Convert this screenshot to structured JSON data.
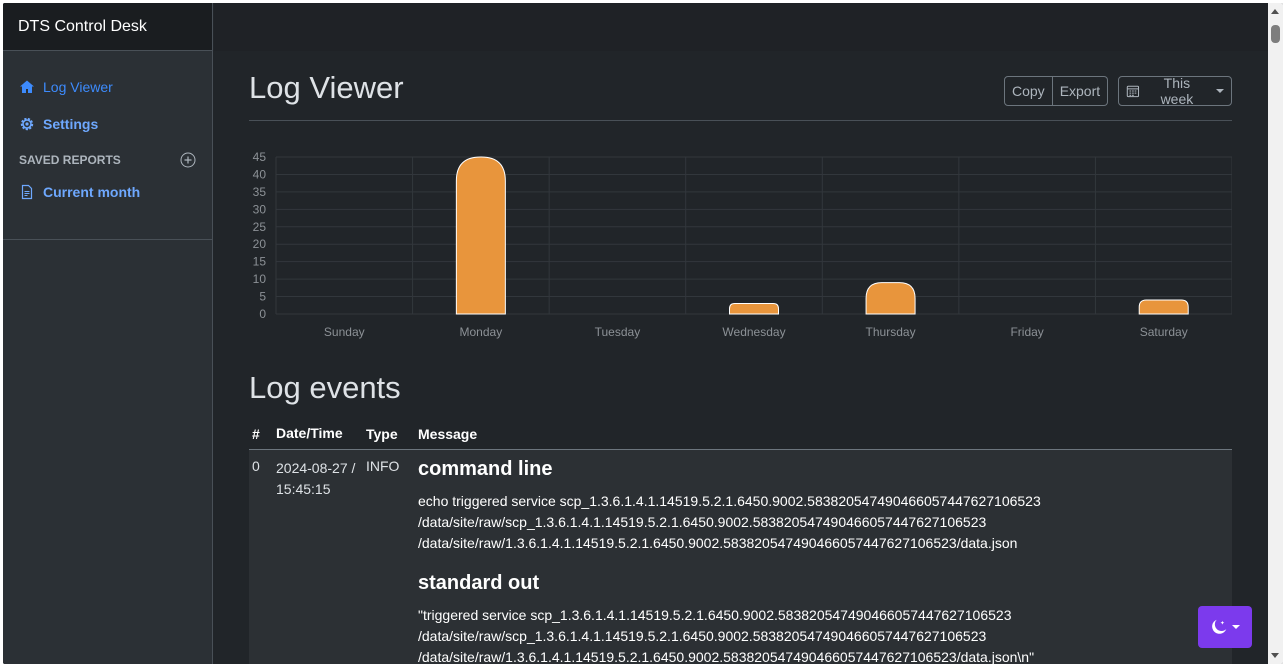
{
  "app": {
    "brand": "DTS Control Desk"
  },
  "sidebar": {
    "items": [
      {
        "label": "Log Viewer",
        "icon": "home-icon"
      },
      {
        "label": "Settings",
        "icon": "gear-icon"
      }
    ],
    "saved_reports_heading": "SAVED REPORTS",
    "reports": [
      {
        "label": "Current month",
        "icon": "document-icon"
      }
    ]
  },
  "header": {
    "title": "Log Viewer",
    "copy_label": "Copy",
    "export_label": "Export",
    "range_label": "This week"
  },
  "chart_data": {
    "type": "bar",
    "categories": [
      "Sunday",
      "Monday",
      "Tuesday",
      "Wednesday",
      "Thursday",
      "Friday",
      "Saturday"
    ],
    "values": [
      0,
      45,
      0,
      3,
      9,
      0,
      4
    ],
    "yticks": [
      0,
      5,
      10,
      15,
      20,
      25,
      30,
      35,
      40,
      45
    ],
    "ylim": [
      0,
      45
    ],
    "bar_color": "#e8953c",
    "grid": true
  },
  "events": {
    "title": "Log events",
    "columns": [
      "#",
      "Date/Time",
      "Type",
      "Message"
    ],
    "rows": [
      {
        "num": "0",
        "date": "2024-08-27 /",
        "time": "15:45:15",
        "type": "INFO",
        "sections": [
          {
            "heading": "command line",
            "lines": [
              "echo triggered service scp_1.3.6.1.4.1.14519.5.2.1.6450.9002.583820547490466057447627106523",
              "/data/site/raw/scp_1.3.6.1.4.1.14519.5.2.1.6450.9002.583820547490466057447627106523",
              "/data/site/raw/1.3.6.1.4.1.14519.5.2.1.6450.9002.583820547490466057447627106523/data.json"
            ]
          },
          {
            "heading": "standard out",
            "lines": [
              "\"triggered service scp_1.3.6.1.4.1.14519.5.2.1.6450.9002.583820547490466057447627106523",
              "/data/site/raw/scp_1.3.6.1.4.1.14519.5.2.1.6450.9002.583820547490466057447627106523",
              "/data/site/raw/1.3.6.1.4.1.14519.5.2.1.6450.9002.583820547490466057447627106523/data.json\\n\""
            ]
          }
        ]
      }
    ]
  },
  "theme_toggle": {
    "icon": "moon-stars-icon",
    "color": "#7c3aed"
  }
}
